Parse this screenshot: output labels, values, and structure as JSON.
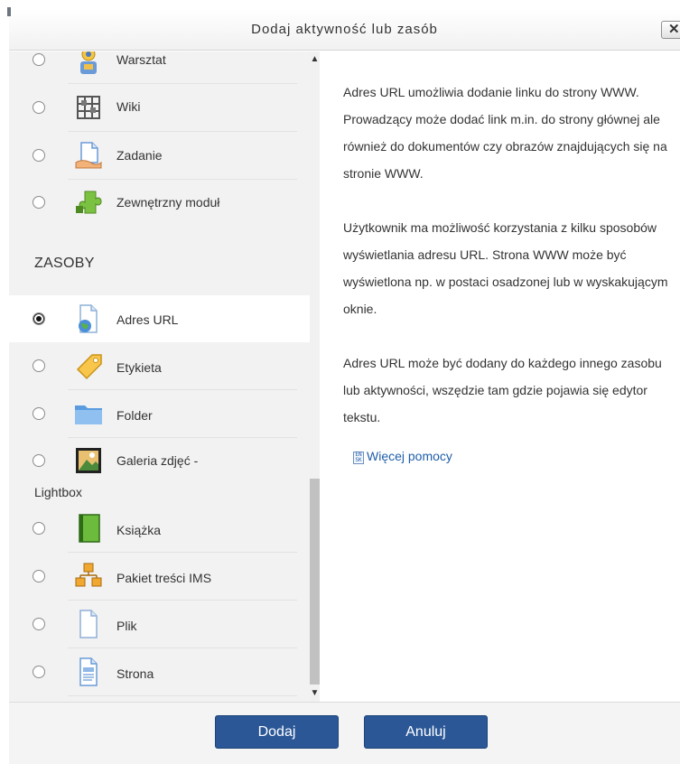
{
  "dialog": {
    "title": "Dodaj aktywność lub zasób",
    "close_label": "✕"
  },
  "activities": [
    {
      "label": "Warsztat",
      "icon": "workshop-icon"
    },
    {
      "label": "Wiki",
      "icon": "wiki-icon"
    },
    {
      "label": "Zadanie",
      "icon": "assignment-icon"
    },
    {
      "label": "Zewnętrzny moduł",
      "icon": "external-tool-icon"
    }
  ],
  "resources_header": "ZASOBY",
  "resources": [
    {
      "label": "Adres URL",
      "icon": "url-icon",
      "selected": true
    },
    {
      "label": "Etykieta",
      "icon": "label-icon"
    },
    {
      "label": "Folder",
      "icon": "folder-icon"
    },
    {
      "label": "Galeria zdjęć -",
      "label2": "Lightbox",
      "icon": "gallery-icon"
    },
    {
      "label": "Książka",
      "icon": "book-icon"
    },
    {
      "label": "Pakiet treści IMS",
      "icon": "ims-package-icon"
    },
    {
      "label": "Plik",
      "icon": "file-icon"
    },
    {
      "label": "Strona",
      "icon": "page-icon"
    }
  ],
  "info": {
    "paragraphs": [
      "Adres URL umożliwia dodanie linku do strony WWW. Prowadzący może dodać link m.in. do strony głównej ale również do dokumentów czy obrazów znajdujących się na stronie WWW.",
      "Użytkownik ma możliwość korzystania z kilku sposobów wyświetlania adresu URL. Strona WWW może być wyświetlona np. w postaci osadzonej lub w wyskakującym oknie.",
      "Adres URL może być dodany do każdego innego zasobu lub aktywności, wszędzie tam gdzie pojawia się edytor tekstu."
    ],
    "help_link": "Więcej pomocy"
  },
  "buttons": {
    "add": "Dodaj",
    "cancel": "Anuluj"
  },
  "colors": {
    "primary_button": "#2b5797",
    "link": "#1f5ea8",
    "list_background": "#f2f2f2"
  }
}
